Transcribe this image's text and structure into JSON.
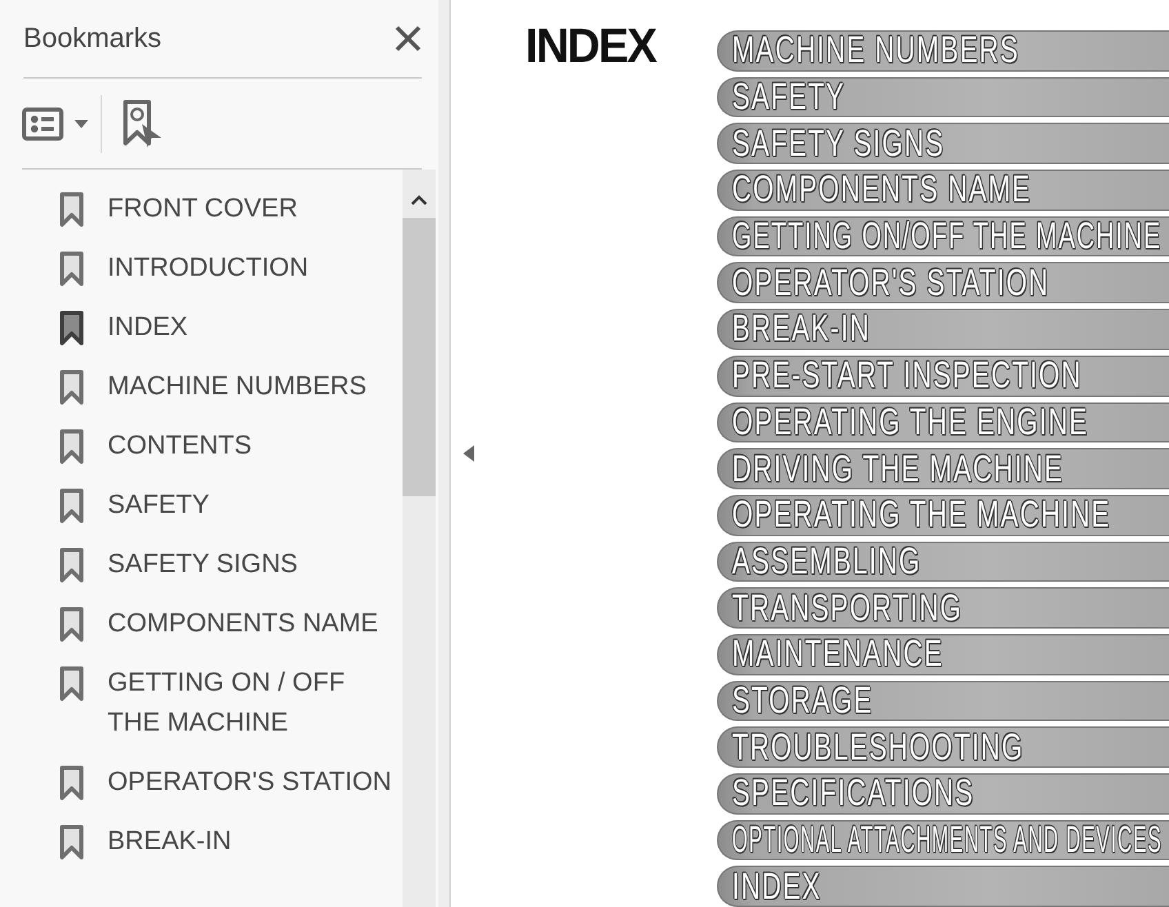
{
  "bookmarks_panel": {
    "title": "Bookmarks",
    "items": [
      {
        "label": "FRONT COVER",
        "selected": false
      },
      {
        "label": "INTRODUCTION",
        "selected": false
      },
      {
        "label": "INDEX",
        "selected": true
      },
      {
        "label": "MACHINE NUMBERS",
        "selected": false
      },
      {
        "label": "CONTENTS",
        "selected": false
      },
      {
        "label": "SAFETY",
        "selected": false
      },
      {
        "label": "SAFETY SIGNS",
        "selected": false
      },
      {
        "label": "COMPONENTS NAME",
        "selected": false
      },
      {
        "label": "GETTING ON / OFF THE MACHINE",
        "selected": false
      },
      {
        "label": "OPERATOR'S STATION",
        "selected": false
      },
      {
        "label": "BREAK-IN",
        "selected": false
      }
    ]
  },
  "document_page": {
    "title": "INDEX",
    "sections": [
      "MACHINE NUMBERS",
      "SAFETY",
      "SAFETY SIGNS",
      "COMPONENTS NAME",
      "GETTING ON/OFF THE MACHINE",
      "OPERATOR'S STATION",
      "BREAK-IN",
      "PRE-START INSPECTION",
      "OPERATING THE ENGINE",
      "DRIVING THE MACHINE",
      "OPERATING THE MACHINE",
      "ASSEMBLING",
      "TRANSPORTING",
      "MAINTENANCE",
      "STORAGE",
      "TROUBLESHOOTING",
      "SPECIFICATIONS",
      "OPTIONAL ATTACHMENTS AND DEVICES",
      "INDEX"
    ]
  }
}
